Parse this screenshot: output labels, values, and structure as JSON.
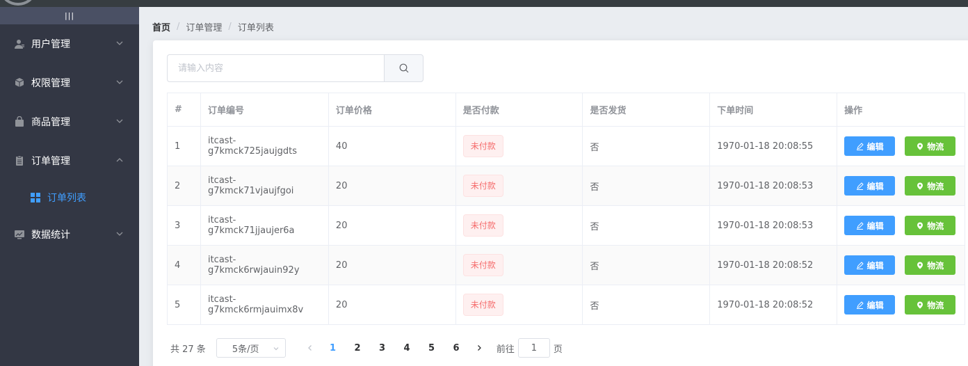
{
  "sidebar": {
    "toggle_label": "|||",
    "menus": [
      {
        "label": "用户管理",
        "icon": "user-icon"
      },
      {
        "label": "权限管理",
        "icon": "cube-icon"
      },
      {
        "label": "商品管理",
        "icon": "bag-icon"
      },
      {
        "label": "订单管理",
        "icon": "document-icon"
      },
      {
        "label": "数据统计",
        "icon": "chart-icon"
      }
    ],
    "active_submenu": {
      "label": "订单列表",
      "icon": "grid-icon"
    }
  },
  "breadcrumb": [
    "首页",
    "订单管理",
    "订单列表"
  ],
  "search": {
    "placeholder": "请输入内容",
    "value": ""
  },
  "table": {
    "headers": [
      "#",
      "订单编号",
      "订单价格",
      "是否付款",
      "是否发货",
      "下单时间",
      "操作"
    ],
    "rows": [
      {
        "index": "1",
        "number": "itcast-g7kmck725jaujgdts",
        "price": "40",
        "paid": "未付款",
        "shipped": "否",
        "time": "1970-01-18 20:08:55"
      },
      {
        "index": "2",
        "number": "itcast-g7kmck71vjaujfgoi",
        "price": "20",
        "paid": "未付款",
        "shipped": "否",
        "time": "1970-01-18 20:08:53"
      },
      {
        "index": "3",
        "number": "itcast-g7kmck71jjaujer6a",
        "price": "20",
        "paid": "未付款",
        "shipped": "否",
        "time": "1970-01-18 20:08:53"
      },
      {
        "index": "4",
        "number": "itcast-g7kmck6rwjauin92y",
        "price": "20",
        "paid": "未付款",
        "shipped": "否",
        "time": "1970-01-18 20:08:52"
      },
      {
        "index": "5",
        "number": "itcast-g7kmck6rmjauimx8v",
        "price": "20",
        "paid": "未付款",
        "shipped": "否",
        "time": "1970-01-18 20:08:52"
      }
    ],
    "edit_label": "编辑",
    "logistics_label": "物流"
  },
  "pagination": {
    "total_text": "共 27 条",
    "page_size": "5条/页",
    "pages": [
      "1",
      "2",
      "3",
      "4",
      "5",
      "6"
    ],
    "current": "1",
    "goto_prefix": "前往",
    "goto_value": "1",
    "goto_suffix": "页"
  },
  "colors": {
    "sidebar_bg": "#333744",
    "accent": "#409eff",
    "success": "#67c23a",
    "danger": "#f56c6c"
  }
}
